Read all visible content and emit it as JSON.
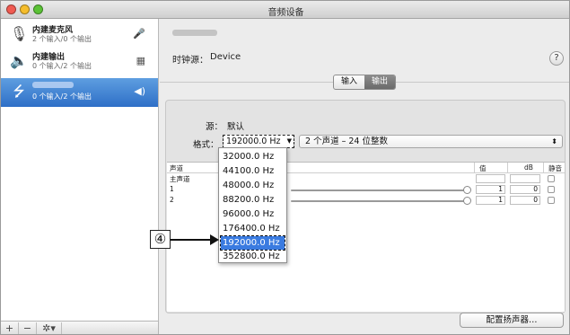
{
  "window": {
    "title": "音频设备"
  },
  "sidebar": {
    "devices": [
      {
        "name": "内建麦克风",
        "sub": "2 个输入/0 个输出",
        "icon": "microphone-icon"
      },
      {
        "name": "内建输出",
        "sub": "0 个输入/2 个输出",
        "icon": "speaker-icon"
      },
      {
        "name": "",
        "sub": "0 个输入/2 个输出",
        "icon": "usb-icon"
      }
    ],
    "footer": {
      "add": "+",
      "remove": "−",
      "gear": "✲▾"
    }
  },
  "main": {
    "clock_label": "时钟源：",
    "clock_value": "Device",
    "help": "?",
    "tabs": [
      "输入",
      "输出"
    ],
    "source_label": "源：",
    "source_value": "默认",
    "format_label": "格式：",
    "format_value": "192000.0 Hz",
    "channels_value": "2 个声道 – 24 位整数",
    "table": {
      "headers": {
        "channel": "声道",
        "value": "值",
        "db": "dB",
        "mute": "静音"
      },
      "rows": [
        {
          "name": "主声道",
          "value": "",
          "db": ""
        },
        {
          "name": "1",
          "value": "1",
          "db": "0"
        },
        {
          "name": "2",
          "value": "1",
          "db": "0"
        }
      ]
    },
    "configure_button": "配置扬声器…"
  },
  "dropdown": {
    "options": [
      "32000.0 Hz",
      "44100.0 Hz",
      "48000.0 Hz",
      "88200.0 Hz",
      "96000.0 Hz",
      "176400.0 Hz",
      "192000.0 Hz",
      "352800.0 Hz"
    ],
    "selected": "192000.0 Hz"
  },
  "callout": {
    "label": "④"
  },
  "colors": {
    "selection": "#3a7be0",
    "sidebar_selected": "#2e6fc7"
  }
}
